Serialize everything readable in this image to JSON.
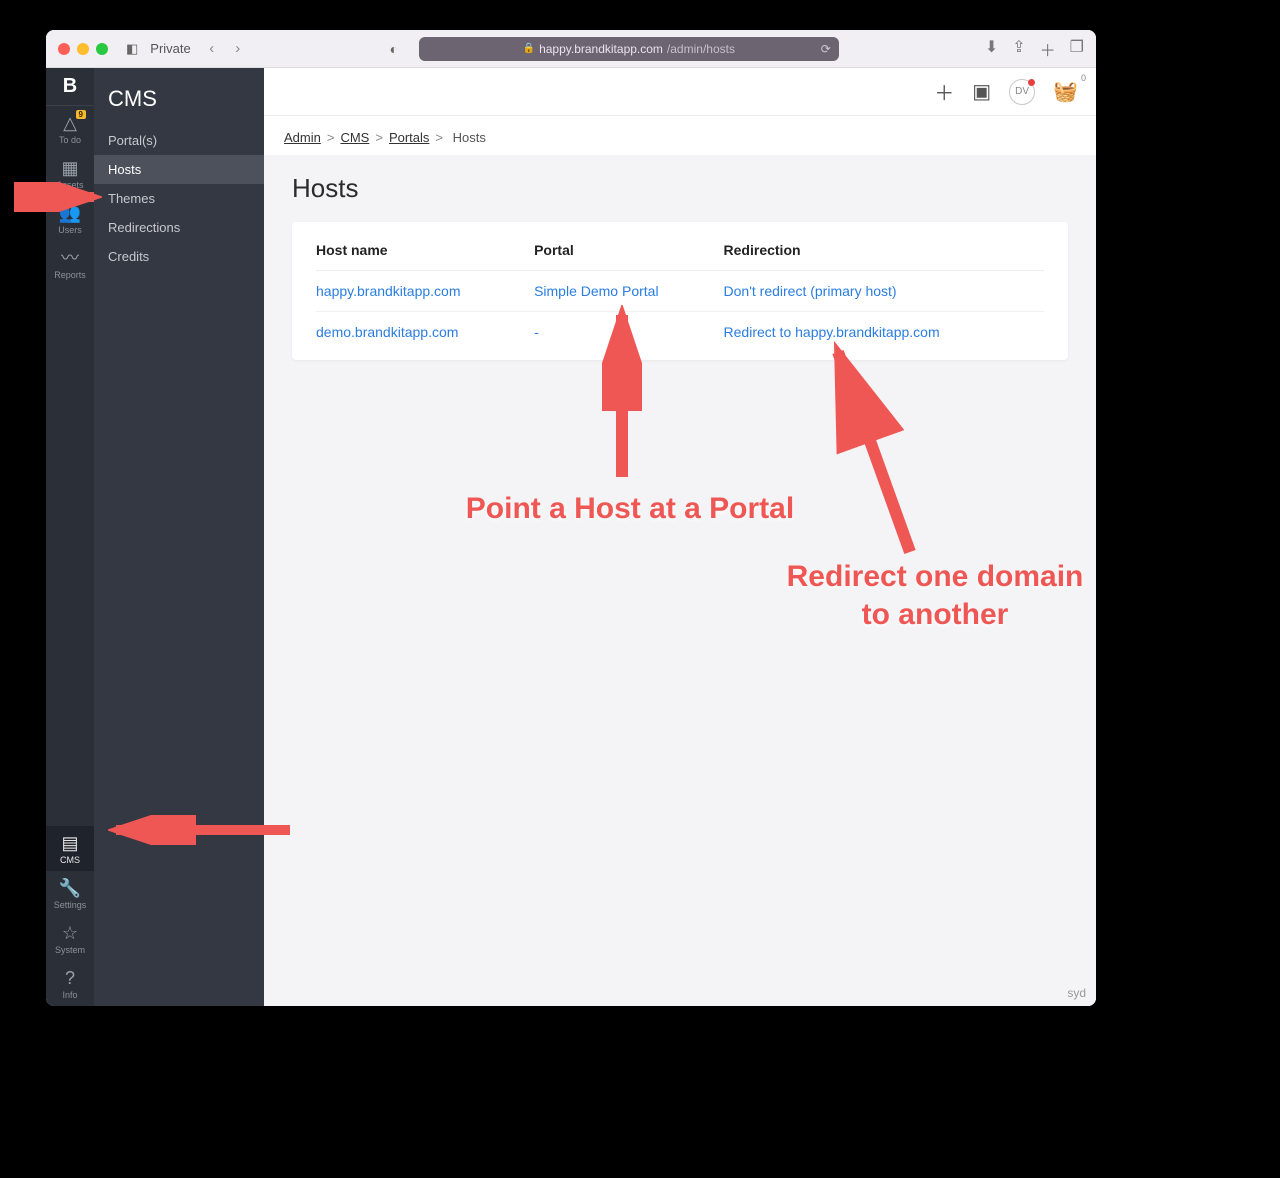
{
  "browser": {
    "private_label": "Private",
    "url_display_prefix": "happy.brandkitapp.com",
    "url_display_suffix": "/admin/hosts"
  },
  "rail": {
    "items_top": [
      {
        "icon": "△",
        "label": "To do",
        "badge": "9"
      },
      {
        "icon": "▦",
        "label": "Assets"
      },
      {
        "icon": "👥",
        "label": "Users"
      },
      {
        "icon": "〰",
        "label": "Reports"
      }
    ],
    "items_bottom": [
      {
        "icon": "▤",
        "label": "CMS",
        "active": true
      },
      {
        "icon": "🔧",
        "label": "Settings"
      },
      {
        "icon": "☆",
        "label": "System"
      },
      {
        "icon": "?",
        "label": "Info"
      }
    ]
  },
  "subnav": {
    "title": "CMS",
    "items": [
      {
        "label": "Portal(s)"
      },
      {
        "label": "Hosts",
        "active": true
      },
      {
        "label": "Themes"
      },
      {
        "label": "Redirections"
      },
      {
        "label": "Credits"
      }
    ]
  },
  "topbar": {
    "avatar_initials": "DV",
    "basket_count": "0"
  },
  "breadcrumbs": {
    "items": [
      "Admin",
      "CMS",
      "Portals"
    ],
    "current": "Hosts"
  },
  "page": {
    "title": "Hosts",
    "columns": [
      "Host name",
      "Portal",
      "Redirection"
    ],
    "rows": [
      {
        "host": "happy.brandkitapp.com",
        "portal": "Simple Demo Portal",
        "redir": "Don't redirect (primary host)"
      },
      {
        "host": "demo.brandkitapp.com",
        "portal": "-",
        "redir": "Redirect to happy.brandkitapp.com"
      }
    ]
  },
  "footer": {
    "marker": "syd"
  },
  "annotations": {
    "a1": "Point a Host at a Portal",
    "a2_line1": "Redirect one domain",
    "a2_line2": "to another"
  }
}
